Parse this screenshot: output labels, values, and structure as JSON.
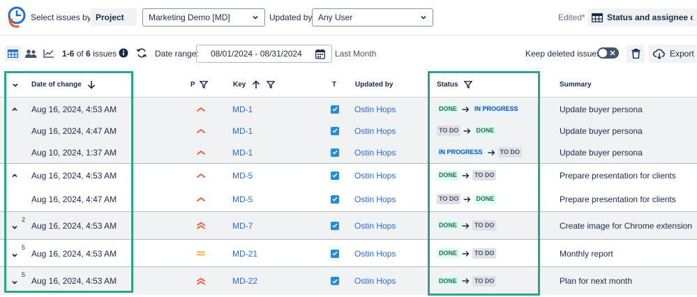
{
  "toolbar": {
    "select_label": "Select issues by:",
    "select_by_value": "Project",
    "project_value": "Marketing Demo [MD]",
    "updated_by_label": "Updated by:",
    "updated_by_value": "Any User",
    "edited_label": "Edited*",
    "view_button": "Status and assignee c..."
  },
  "subbar": {
    "count_range": "1-6",
    "count_of": "of",
    "count_total": "6",
    "count_suffix": "issues",
    "date_range_label": "Date range:",
    "date_range_value": "08/01/2024 - 08/31/2024",
    "date_preset": "Last Month",
    "keep_deleted_label": "Keep deleted issues",
    "export_label": "Export"
  },
  "columns": {
    "date": "Date of change",
    "priority": "P",
    "key": "Key",
    "type": "T",
    "updated_by": "Updated by",
    "status": "Status",
    "summary": "Summary"
  },
  "rows": [
    {
      "date": "Aug 16, 2024, 4:53 AM",
      "priority": "high",
      "key": "MD-1",
      "user": "Ostin Hops",
      "from": "DONE",
      "to": "IN PROGRESS",
      "summary": "Update buyer persona"
    },
    {
      "date": "Aug 16, 2024, 4:47 AM",
      "priority": "high",
      "key": "MD-1",
      "user": "Ostin Hops",
      "from": "TO DO",
      "to": "DONE",
      "summary": "Update buyer persona"
    },
    {
      "date": "Aug 10, 2024, 1:37 AM",
      "priority": "high",
      "key": "MD-1",
      "user": "Ostin Hops",
      "from": "IN PROGRESS",
      "to": "TO DO",
      "summary": "Update buyer persona"
    },
    {
      "date": "Aug 16, 2024, 4:53 AM",
      "priority": "high",
      "key": "MD-5",
      "user": "Ostin Hops",
      "from": "DONE",
      "to": "TO DO",
      "summary": "Prepare presentation for clients"
    },
    {
      "date": "Aug 16, 2024, 4:47 AM",
      "priority": "high",
      "key": "MD-5",
      "user": "Ostin Hops",
      "from": "TO DO",
      "to": "DONE",
      "summary": "Prepare presentation for clients"
    },
    {
      "date": "Aug 16, 2024, 4:53 AM",
      "priority": "highest",
      "key": "MD-7",
      "user": "Ostin Hops",
      "from": "DONE",
      "to": "TO DO",
      "summary": "Create image for Chrome extension",
      "count": "2"
    },
    {
      "date": "Aug 16, 2024, 4:53 AM",
      "priority": "medium",
      "key": "MD-21",
      "user": "Ostin Hops",
      "from": "DONE",
      "to": "TO DO",
      "summary": "Monthly report",
      "count": "5"
    },
    {
      "date": "Aug 16, 2024, 4:53 AM",
      "priority": "highest",
      "key": "MD-22",
      "user": "Ostin Hops",
      "from": "DONE",
      "to": "TO DO",
      "summary": "Plan for next month",
      "count": "5"
    }
  ],
  "colors": {
    "accent": "#1f8ddb",
    "highlight": "#2ba58a",
    "priority_high": "#f15b2b",
    "priority_medium": "#f5a623"
  }
}
